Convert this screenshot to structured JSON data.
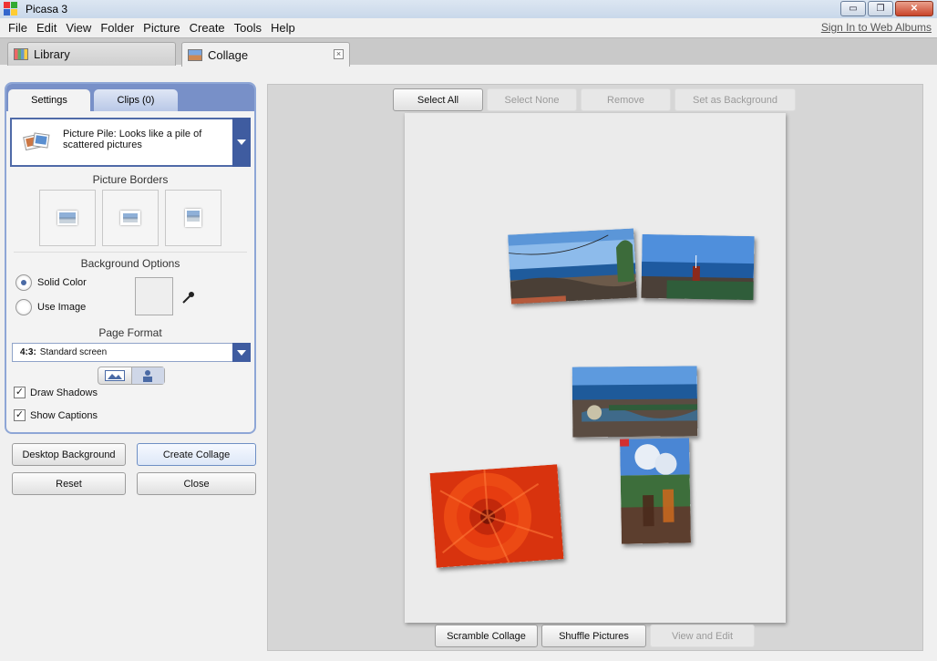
{
  "window": {
    "title": "Picasa 3",
    "buttons": {
      "minimize": "▭",
      "restore": "❐",
      "close": "✕"
    }
  },
  "menu": [
    "File",
    "Edit",
    "View",
    "Folder",
    "Picture",
    "Create",
    "Tools",
    "Help"
  ],
  "signin_link": "Sign In to Web Albums",
  "tabs": {
    "library": "Library",
    "collage": "Collage",
    "close": "×"
  },
  "panel": {
    "tabs": {
      "settings": "Settings",
      "clips": "Clips (0)"
    },
    "collage_style": "Picture Pile:  Looks like a pile of scattered pictures",
    "picture_borders_title": "Picture Borders",
    "background_options_title": "Background Options",
    "solid_color": "Solid Color",
    "use_image": "Use Image",
    "page_format_title": "Page Format",
    "page_format": {
      "bold": "4:3:",
      "rest": "Standard screen"
    },
    "draw_shadows": "Draw Shadows",
    "show_captions": "Show Captions",
    "check_mark": "✓",
    "buttons": {
      "desktop_background": "Desktop Background",
      "create_collage": "Create Collage",
      "reset": "Reset",
      "close": "Close"
    }
  },
  "canvas": {
    "top_buttons": {
      "select_all": "Select All",
      "select_none": "Select None",
      "remove": "Remove",
      "set_background": "Set as Background"
    },
    "bottom_buttons": {
      "scramble": "Scramble Collage",
      "shuffle": "Shuffle Pictures",
      "view_edit": "View and Edit"
    }
  },
  "colors": {
    "accent_blue": "#3f5ca0",
    "panel_border": "#8ea6d6",
    "canvas_bg": "#d6d6d6",
    "page_bg": "#ebebeb"
  }
}
